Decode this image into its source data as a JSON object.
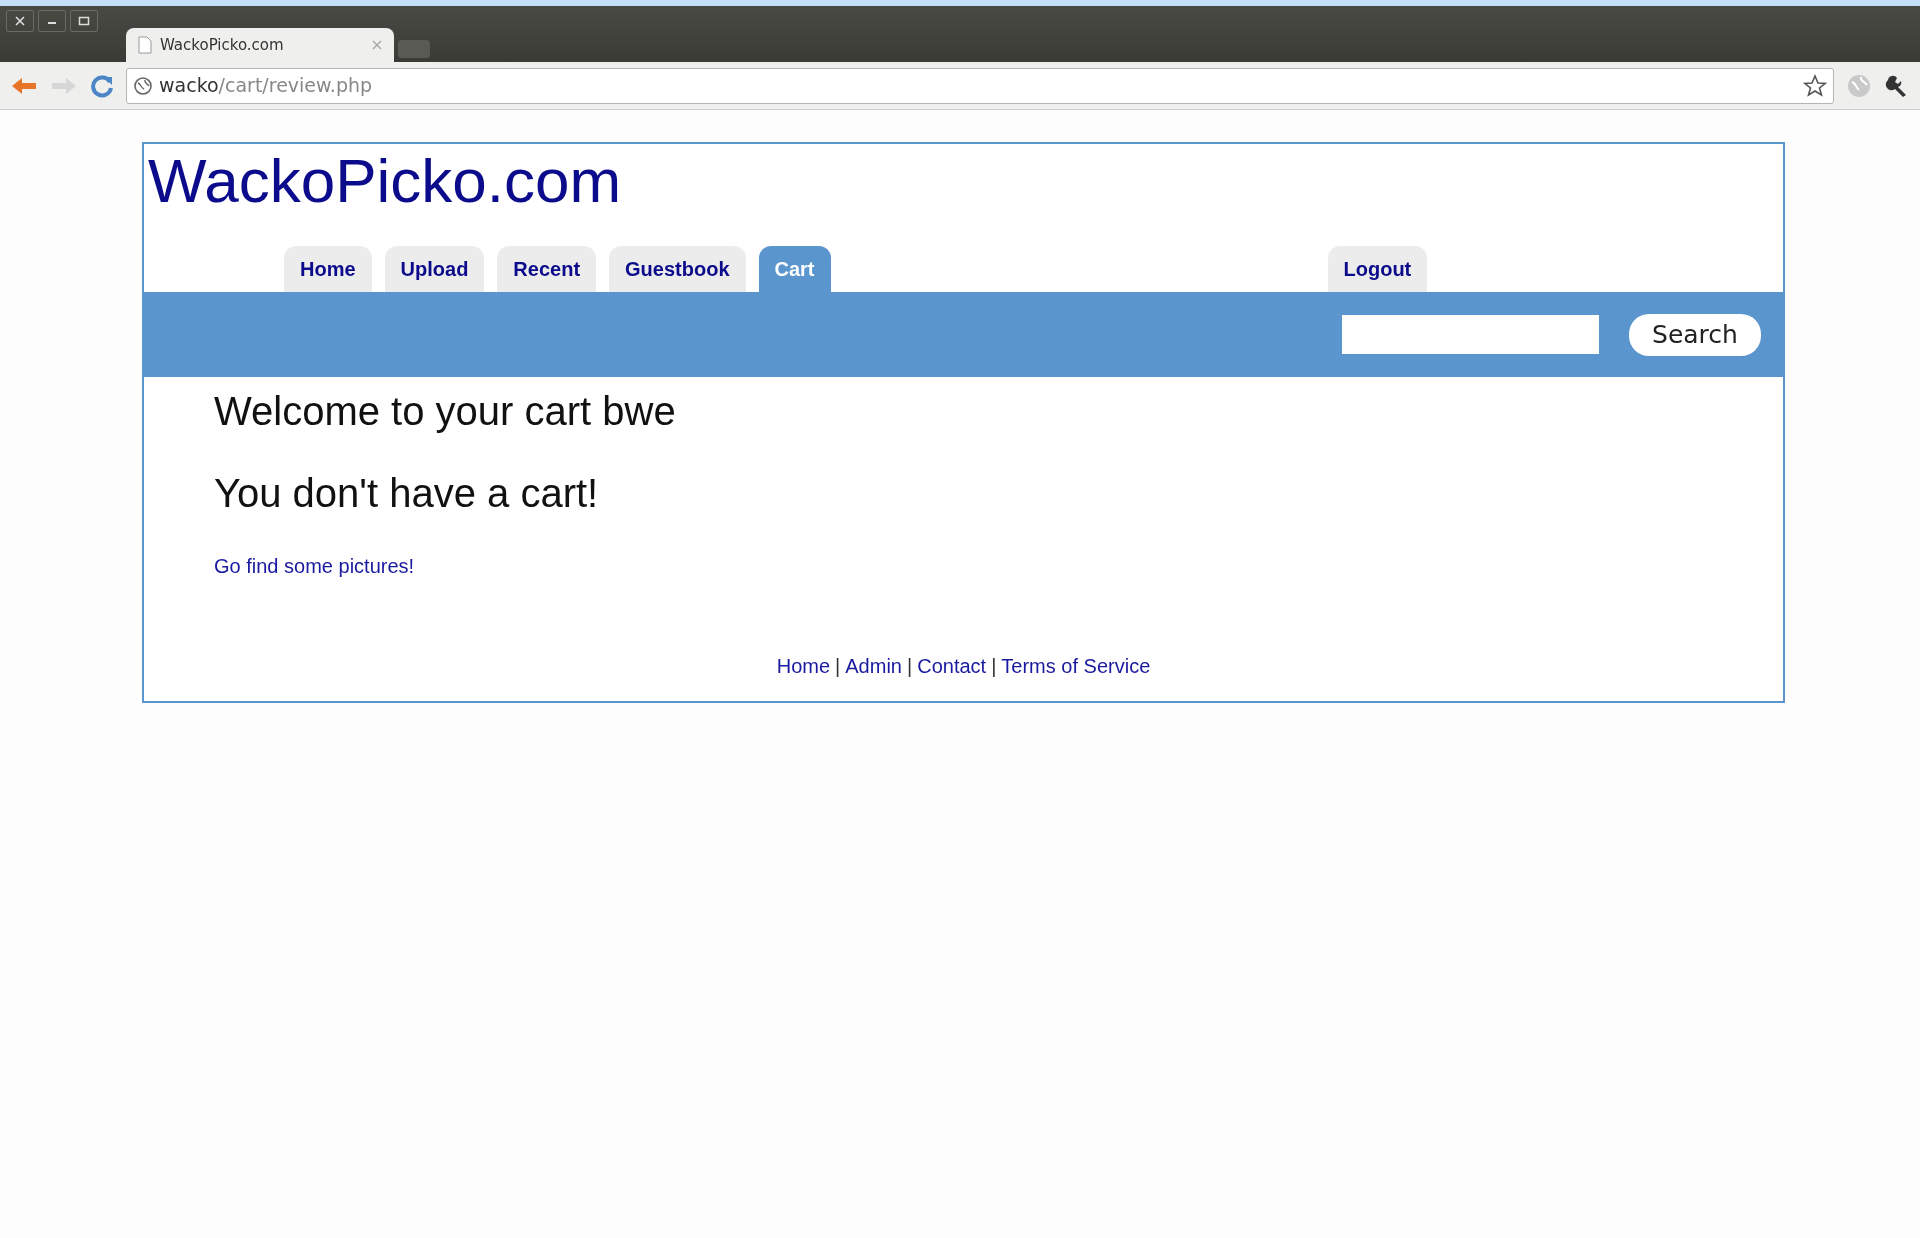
{
  "browser": {
    "tab_title": "WackoPicko.com",
    "address": {
      "host": "wacko",
      "path": "/cart/review.php"
    }
  },
  "site": {
    "logo": "WackoPicko.com",
    "tabs": [
      {
        "label": "Home",
        "selected": false
      },
      {
        "label": "Upload",
        "selected": false
      },
      {
        "label": "Recent",
        "selected": false
      },
      {
        "label": "Guestbook",
        "selected": false
      },
      {
        "label": "Cart",
        "selected": true
      }
    ],
    "right_tabs": [
      {
        "label": "Logout",
        "selected": false
      }
    ],
    "search": {
      "button": "Search"
    }
  },
  "content": {
    "welcome": "Welcome to your cart bwe",
    "message": "You don't have a cart!",
    "link": "Go find some pictures!"
  },
  "footer": {
    "separator": "|",
    "links": [
      "Home",
      "Admin",
      "Contact",
      "Terms of Service"
    ]
  }
}
